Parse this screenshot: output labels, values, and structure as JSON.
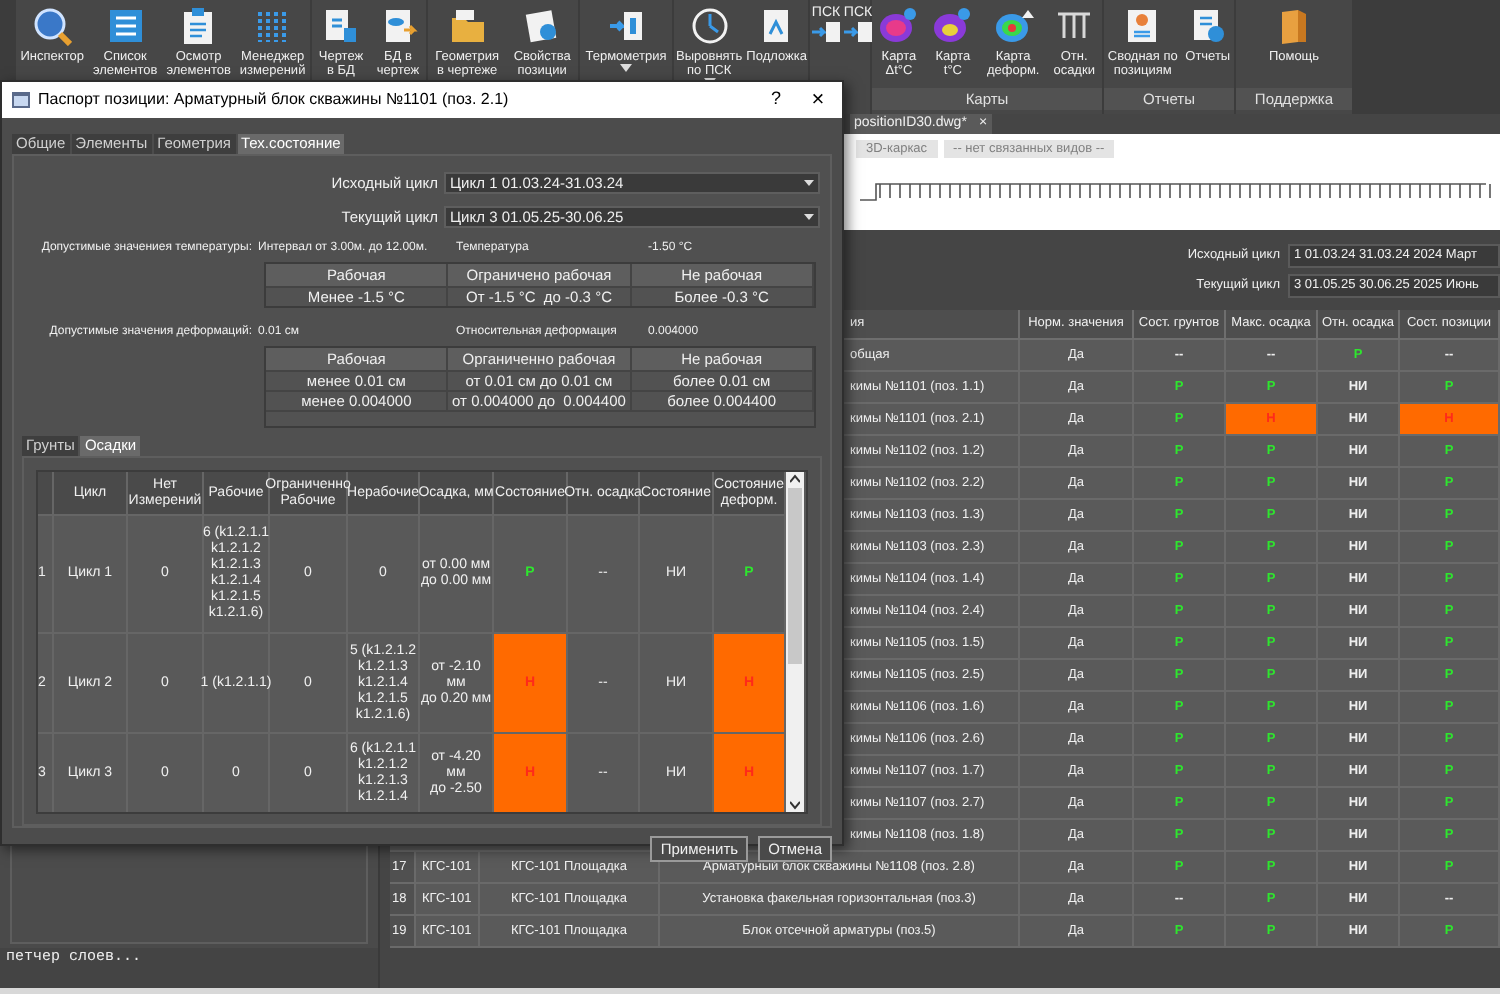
{
  "ribbon": {
    "groups": [
      {
        "buttons": [
          {
            "label": "Инспектор"
          },
          {
            "label": "Список\nэлементов"
          },
          {
            "label": "Осмотр\nэлементов"
          },
          {
            "label": "Менеджер\nизмерений"
          }
        ]
      },
      {
        "buttons": [
          {
            "label": "Чертеж\nв БД"
          },
          {
            "label": "БД в\nчертеж"
          }
        ]
      },
      {
        "buttons": [
          {
            "label": "Геометрия\nв чертеже"
          },
          {
            "label": "Свойства\nпозиции"
          }
        ]
      },
      {
        "buttons": [
          {
            "label": "Термометрия",
            "dropdown": true
          }
        ]
      },
      {
        "buttons": [
          {
            "label": "Выровнять\nпо ПСК",
            "dropdown": true
          },
          {
            "label": "Подложка"
          }
        ]
      },
      {
        "small": [
          {
            "label": "ПСК"
          },
          {
            "label": "ПСК"
          }
        ]
      },
      {
        "label": "Карты",
        "buttons": [
          {
            "label": "Карта\nΔt°C"
          },
          {
            "label": "Карта\nt°C"
          },
          {
            "label": "Карта\nдеформ."
          },
          {
            "label": "Отн.\nосадки"
          }
        ]
      },
      {
        "label": "Отчеты",
        "buttons": [
          {
            "label": "Сводная по\nпозициям"
          },
          {
            "label": "Отчеты"
          }
        ]
      },
      {
        "label": "Поддержка",
        "buttons": [
          {
            "label": "Помощь"
          }
        ]
      }
    ]
  },
  "drawing_tab": {
    "title": "positionID30.dwg*",
    "close": "×"
  },
  "view_buttons": [
    "3D-каркас",
    "-- нет связанных видов --"
  ],
  "cycles": [
    {
      "label": "Исходный цикл",
      "value": "1 01.03.24 31.03.24 2024 Март"
    },
    {
      "label": "Текущий цикл",
      "value": "3 01.05.25 30.06.25 2025 Июнь"
    }
  ],
  "positions_table": {
    "columns": [
      "ия",
      "Норм. значения",
      "Сост. грунтов",
      "Макс. осадка",
      "Отн. осадка",
      "Сост. позиции"
    ],
    "rows": [
      {
        "name": "общая",
        "norm": "Да",
        "states": [
          {
            "text": "--",
            "kind": "plain"
          },
          {
            "text": "--",
            "kind": "plain"
          },
          {
            "text": "Р",
            "kind": "ok"
          },
          {
            "text": "--",
            "kind": "plain"
          }
        ]
      },
      {
        "name": "кимы №1101 (поз. 1.1)",
        "norm": "Да",
        "states": [
          {
            "text": "Р",
            "kind": "ok"
          },
          {
            "text": "Р",
            "kind": "ok"
          },
          {
            "text": "НИ",
            "kind": "plain"
          },
          {
            "text": "Р",
            "kind": "ok"
          }
        ]
      },
      {
        "name": "кимы №1101 (поз. 2.1)",
        "norm": "Да",
        "states": [
          {
            "text": "Р",
            "kind": "ok"
          },
          {
            "text": "Н",
            "kind": "fail"
          },
          {
            "text": "НИ",
            "kind": "plain"
          },
          {
            "text": "Н",
            "kind": "fail"
          }
        ]
      },
      {
        "name": "кимы №1102 (поз. 1.2)",
        "norm": "Да",
        "states": [
          {
            "text": "Р",
            "kind": "ok"
          },
          {
            "text": "Р",
            "kind": "ok"
          },
          {
            "text": "НИ",
            "kind": "plain"
          },
          {
            "text": "Р",
            "kind": "ok"
          }
        ]
      },
      {
        "name": "кимы №1102 (поз. 2.2)",
        "norm": "Да",
        "states": [
          {
            "text": "Р",
            "kind": "ok"
          },
          {
            "text": "Р",
            "kind": "ok"
          },
          {
            "text": "НИ",
            "kind": "plain"
          },
          {
            "text": "Р",
            "kind": "ok"
          }
        ]
      },
      {
        "name": "кимы №1103 (поз. 1.3)",
        "norm": "Да",
        "states": [
          {
            "text": "Р",
            "kind": "ok"
          },
          {
            "text": "Р",
            "kind": "ok"
          },
          {
            "text": "НИ",
            "kind": "plain"
          },
          {
            "text": "Р",
            "kind": "ok"
          }
        ]
      },
      {
        "name": "кимы №1103 (поз. 2.3)",
        "norm": "Да",
        "states": [
          {
            "text": "Р",
            "kind": "ok"
          },
          {
            "text": "Р",
            "kind": "ok"
          },
          {
            "text": "НИ",
            "kind": "plain"
          },
          {
            "text": "Р",
            "kind": "ok"
          }
        ]
      },
      {
        "name": "кимы №1104 (поз. 1.4)",
        "norm": "Да",
        "states": [
          {
            "text": "Р",
            "kind": "ok"
          },
          {
            "text": "Р",
            "kind": "ok"
          },
          {
            "text": "НИ",
            "kind": "plain"
          },
          {
            "text": "Р",
            "kind": "ok"
          }
        ]
      },
      {
        "name": "кимы №1104 (поз. 2.4)",
        "norm": "Да",
        "states": [
          {
            "text": "Р",
            "kind": "ok"
          },
          {
            "text": "Р",
            "kind": "ok"
          },
          {
            "text": "НИ",
            "kind": "plain"
          },
          {
            "text": "Р",
            "kind": "ok"
          }
        ]
      },
      {
        "name": "кимы №1105 (поз. 1.5)",
        "norm": "Да",
        "states": [
          {
            "text": "Р",
            "kind": "ok"
          },
          {
            "text": "Р",
            "kind": "ok"
          },
          {
            "text": "НИ",
            "kind": "plain"
          },
          {
            "text": "Р",
            "kind": "ok"
          }
        ]
      },
      {
        "name": "кимы №1105 (поз. 2.5)",
        "norm": "Да",
        "states": [
          {
            "text": "Р",
            "kind": "ok"
          },
          {
            "text": "Р",
            "kind": "ok"
          },
          {
            "text": "НИ",
            "kind": "plain"
          },
          {
            "text": "Р",
            "kind": "ok"
          }
        ]
      },
      {
        "name": "кимы №1106 (поз. 1.6)",
        "norm": "Да",
        "states": [
          {
            "text": "Р",
            "kind": "ok"
          },
          {
            "text": "Р",
            "kind": "ok"
          },
          {
            "text": "НИ",
            "kind": "plain"
          },
          {
            "text": "Р",
            "kind": "ok"
          }
        ]
      },
      {
        "name": "кимы №1106 (поз. 2.6)",
        "norm": "Да",
        "states": [
          {
            "text": "Р",
            "kind": "ok"
          },
          {
            "text": "Р",
            "kind": "ok"
          },
          {
            "text": "НИ",
            "kind": "plain"
          },
          {
            "text": "Р",
            "kind": "ok"
          }
        ]
      },
      {
        "name": "кимы №1107 (поз. 1.7)",
        "norm": "Да",
        "states": [
          {
            "text": "Р",
            "kind": "ok"
          },
          {
            "text": "Р",
            "kind": "ok"
          },
          {
            "text": "НИ",
            "kind": "plain"
          },
          {
            "text": "Р",
            "kind": "ok"
          }
        ]
      },
      {
        "name": "кимы №1107 (поз. 2.7)",
        "norm": "Да",
        "states": [
          {
            "text": "Р",
            "kind": "ok"
          },
          {
            "text": "Р",
            "kind": "ok"
          },
          {
            "text": "НИ",
            "kind": "plain"
          },
          {
            "text": "Р",
            "kind": "ok"
          }
        ]
      },
      {
        "name": "кимы №1108 (поз. 1.8)",
        "norm": "Да",
        "states": [
          {
            "text": "Р",
            "kind": "ok"
          },
          {
            "text": "Р",
            "kind": "ok"
          },
          {
            "text": "НИ",
            "kind": "plain"
          },
          {
            "text": "Р",
            "kind": "ok"
          }
        ]
      },
      {
        "num": "17",
        "code": "КГС-101",
        "site": "КГС-101 Площадка",
        "name": "Арматурный блок скважины №1108 (поз. 2.8)",
        "norm": "Да",
        "states": [
          {
            "text": "Р",
            "kind": "ok"
          },
          {
            "text": "Р",
            "kind": "ok"
          },
          {
            "text": "НИ",
            "kind": "plain"
          },
          {
            "text": "Р",
            "kind": "ok"
          }
        ]
      },
      {
        "num": "18",
        "code": "КГС-101",
        "site": "КГС-101 Площадка",
        "name": "Установка факельная горизонтальная (поз.3)",
        "norm": "Да",
        "states": [
          {
            "text": "--",
            "kind": "plain"
          },
          {
            "text": "Р",
            "kind": "ok"
          },
          {
            "text": "НИ",
            "kind": "plain"
          },
          {
            "text": "--",
            "kind": "plain"
          }
        ]
      },
      {
        "num": "19",
        "code": "КГС-101",
        "site": "КГС-101 Площадка",
        "name": "Блок отсечной арматуры (поз.5)",
        "norm": "Да",
        "states": [
          {
            "text": "Р",
            "kind": "ok"
          },
          {
            "text": "Р",
            "kind": "ok"
          },
          {
            "text": "НИ",
            "kind": "plain"
          },
          {
            "text": "Р",
            "kind": "ok"
          }
        ]
      }
    ]
  },
  "command_line": "петчер слоев...",
  "dialog": {
    "title": "Паспорт позиции: Арматурный блок скважины №1101 (поз. 2.1)",
    "help": "?",
    "close": "×",
    "tabs": [
      {
        "label": "Общие",
        "selected": false
      },
      {
        "label": "Элементы",
        "selected": false
      },
      {
        "label": "Геометрия",
        "selected": false
      },
      {
        "label": "Тех.состояние",
        "selected": true
      }
    ],
    "cycles": [
      {
        "label": "Исходный цикл",
        "value": "Цикл 1 01.03.24-31.03.24"
      },
      {
        "label": "Текущий цикл",
        "value": "Цикл 3 01.05.25-30.06.25"
      }
    ],
    "temperature": {
      "label": "Допустимые значениея температуры:",
      "value": "Интервал от 3.00м. до 12.00м.",
      "reading_label": "Температура",
      "reading": "-1.50 °C",
      "columns": [
        "Рабочая",
        "Ограничено рабочая",
        "Не рабочая"
      ],
      "rows": [
        [
          "Менее -1.5 °C",
          "От -1.5 °C  до -0.3 °C",
          "Более -0.3 °C"
        ]
      ]
    },
    "deformation": {
      "label": "Допустимые значения деформаций:",
      "value": "0.01 см",
      "reading_label": "Относительная деформация",
      "reading": "0.004000",
      "columns": [
        "Рабочая",
        "Органиченно рабочая",
        "Не рабочая"
      ],
      "rows": [
        [
          "менее 0.01 см",
          "от 0.01 см до 0.01 см",
          "более 0.01 см"
        ],
        [
          "менее 0.004000",
          "от 0.004000 до  0.004400",
          "более 0.004400"
        ]
      ]
    },
    "subtabs": [
      {
        "label": "Грунты",
        "selected": false
      },
      {
        "label": "Осадки",
        "selected": true
      }
    ],
    "settlement_table": {
      "columns": [
        "Цикл",
        "Нет\nИзмерений",
        "Рабочие",
        "Ограниченно\nРабочие",
        "Нерабочие",
        "Осадка, мм",
        "Состояние",
        "Отн. осадка",
        "Состояние",
        "Состояние\nдеформ."
      ],
      "rows": [
        {
          "index": "1",
          "cells": [
            "Цикл 1",
            "0",
            "6 (k1.2.1.1\nk1.2.1.2\nk1.2.1.3\nk1.2.1.4\nk1.2.1.5\nk1.2.1.6)",
            "0",
            "0",
            "от 0.00 мм\nдо 0.00 мм",
            {
              "text": "Р",
              "kind": "ok"
            },
            "--",
            "НИ",
            {
              "text": "Р",
              "kind": "ok"
            }
          ]
        },
        {
          "index": "2",
          "cells": [
            "Цикл 2",
            "0",
            "1 (k1.2.1.1)",
            "0",
            "5 (k1.2.1.2\nk1.2.1.3\nk1.2.1.4\nk1.2.1.5\nk1.2.1.6)",
            "от -2.10\nмм\nдо 0.20 мм",
            {
              "text": "Н",
              "kind": "fail"
            },
            "--",
            "НИ",
            {
              "text": "Н",
              "kind": "fail"
            }
          ]
        },
        {
          "index": "3",
          "cells": [
            "Цикл 3",
            "0",
            "0",
            "0",
            "6 (k1.2.1.1\nk1.2.1.2\nk1.2.1.3\nk1.2.1.4",
            "от -4.20\nмм\nдо -2.50",
            {
              "text": "Н",
              "kind": "fail"
            },
            "--",
            "НИ",
            {
              "text": "Н",
              "kind": "fail"
            }
          ]
        }
      ]
    },
    "buttons": [
      "Применить",
      "Отмена"
    ]
  }
}
